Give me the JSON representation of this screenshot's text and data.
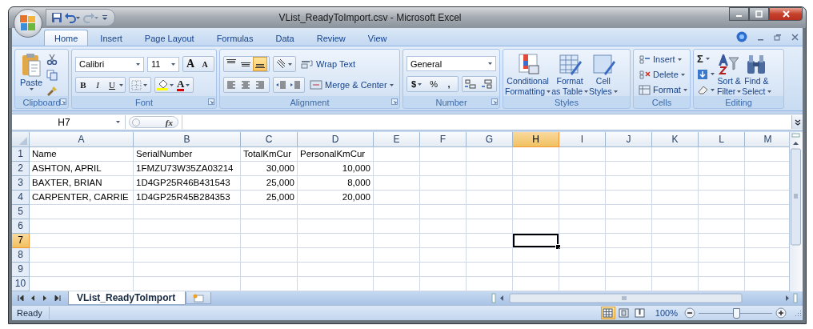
{
  "window": {
    "title": "VList_ReadyToImport.csv - Microsoft Excel"
  },
  "ribbon_tabs": [
    {
      "label": "Home",
      "selected": true
    },
    {
      "label": "Insert",
      "selected": false
    },
    {
      "label": "Page Layout",
      "selected": false
    },
    {
      "label": "Formulas",
      "selected": false
    },
    {
      "label": "Data",
      "selected": false
    },
    {
      "label": "Review",
      "selected": false
    },
    {
      "label": "View",
      "selected": false
    }
  ],
  "ribbon": {
    "clipboard": {
      "label": "Clipboard",
      "launcher": true,
      "paste": "Paste"
    },
    "font": {
      "label": "Font",
      "launcher": true,
      "font_name": "Calibri",
      "font_size": "11",
      "grow": "A",
      "shrink": "A",
      "bold": "B",
      "italic": "I",
      "underline": "U",
      "font_color": "A"
    },
    "alignment": {
      "label": "Alignment",
      "launcher": true,
      "vertical_align": [
        {
          "selected": false
        },
        {
          "selected": false
        },
        {
          "selected": true
        }
      ],
      "wrap_text": "Wrap Text",
      "merge": "Merge & Center"
    },
    "number": {
      "label": "Number",
      "launcher": true,
      "format": "General",
      "currency": "$",
      "percent": "%",
      "comma": ","
    },
    "styles": {
      "label": "Styles",
      "launcher": false,
      "buttons": [
        {
          "top": "Conditional",
          "bottom": "Formatting"
        },
        {
          "top": "Format",
          "bottom": "as Table"
        },
        {
          "top": "Cell",
          "bottom": "Styles"
        }
      ]
    },
    "cells": {
      "label": "Cells",
      "launcher": false,
      "buttons": [
        "Insert",
        "Delete",
        "Format"
      ]
    },
    "editing": {
      "label": "Editing",
      "launcher": false,
      "sum": "Σ",
      "buttons": [
        {
          "top": "Sort &",
          "bottom": "Filter"
        },
        {
          "top": "Find &",
          "bottom": "Select"
        }
      ]
    }
  },
  "formula_bar": {
    "name_box": "H7",
    "fx": "fx"
  },
  "sheet": {
    "columns": [
      {
        "label": "A",
        "selected": false
      },
      {
        "label": "B",
        "selected": false
      },
      {
        "label": "C",
        "selected": false
      },
      {
        "label": "D",
        "selected": false
      },
      {
        "label": "E",
        "selected": false
      },
      {
        "label": "F",
        "selected": false
      },
      {
        "label": "G",
        "selected": false
      },
      {
        "label": "H",
        "selected": true
      },
      {
        "label": "I",
        "selected": false
      },
      {
        "label": "J",
        "selected": false
      },
      {
        "label": "K",
        "selected": false
      },
      {
        "label": "L",
        "selected": false
      },
      {
        "label": "M",
        "selected": false
      }
    ],
    "rows": [
      {
        "label": "1",
        "selected": false,
        "cells": [
          {
            "text": "Name",
            "kind": "text"
          },
          {
            "text": "SerialNumber",
            "kind": "text"
          },
          {
            "text": "TotalKmCur",
            "kind": "text"
          },
          {
            "text": "PersonalKmCur",
            "kind": "text"
          }
        ]
      },
      {
        "label": "2",
        "selected": false,
        "cells": [
          {
            "text": "ASHTON, APRIL",
            "kind": "text"
          },
          {
            "text": "1FMZU73W35ZA03214",
            "kind": "text"
          },
          {
            "text": "30,000",
            "kind": "number"
          },
          {
            "text": "10,000",
            "kind": "number"
          }
        ]
      },
      {
        "label": "3",
        "selected": false,
        "cells": [
          {
            "text": "BAXTER, BRIAN",
            "kind": "text"
          },
          {
            "text": "1D4GP25R46B431543",
            "kind": "text"
          },
          {
            "text": "25,000",
            "kind": "number"
          },
          {
            "text": "8,000",
            "kind": "number"
          }
        ]
      },
      {
        "label": "4",
        "selected": false,
        "cells": [
          {
            "text": "CARPENTER, CARRIE",
            "kind": "text"
          },
          {
            "text": "1D4GP25R45B284353",
            "kind": "text"
          },
          {
            "text": "25,000",
            "kind": "number"
          },
          {
            "text": "20,000",
            "kind": "number"
          }
        ]
      },
      {
        "label": "5",
        "selected": false
      },
      {
        "label": "6",
        "selected": false
      },
      {
        "label": "7",
        "selected": true
      },
      {
        "label": "8",
        "selected": false
      },
      {
        "label": "9",
        "selected": false
      },
      {
        "label": "10",
        "selected": false
      }
    ]
  },
  "sheet_tabs": [
    {
      "label": "VList_ReadyToImport",
      "selected": true
    }
  ],
  "status_bar": {
    "status": "Ready",
    "views": [
      {
        "selected": true
      },
      {
        "selected": false
      },
      {
        "selected": false
      }
    ],
    "zoom": "100%",
    "zoom_slider": {
      "level": 0.5
    }
  }
}
